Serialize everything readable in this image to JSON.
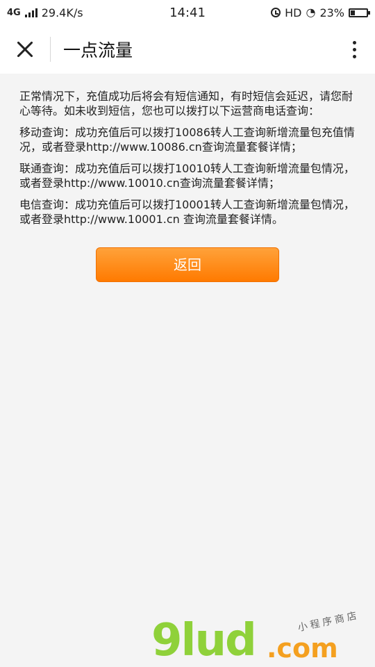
{
  "status_bar": {
    "network_type": "4G",
    "speed": "29.4K/s",
    "time": "14:41",
    "hd_label": "HD",
    "battery": "23%",
    "icons": [
      "signal-icon",
      "alarm-icon",
      "wifi-icon",
      "battery-icon"
    ]
  },
  "header": {
    "title": "一点流量",
    "close_icon": "close-icon",
    "more_icon": "more-icon"
  },
  "main": {
    "intro": "正常情况下，充值成功后将会有短信通知，有时短信会延迟，请您耐心等待。如未收到短信，您也可以拨打以下运营商电话查询：",
    "mobile": "移动查询：成功充值后可以拨打10086转人工查询新增流量包充值情况，或者登录http://www.10086.cn查询流量套餐详情；",
    "unicom": "联通查询：成功充值后可以拨打10010转人工查询新增流量包情况，或者登录http://www.10010.cn查询流量套餐详情；",
    "telecom": "电信查询：成功充值后可以拨打10001转人工查询新增流量包情况，或者登录http://www.10001.cn 查询流量套餐详情。",
    "back_label": "返回"
  },
  "watermark": {
    "brand": "9lud",
    "domain": ".com",
    "tag": "小程序商店"
  },
  "colors": {
    "button_top": "#ffa23a",
    "button_bottom": "#ff7a00",
    "background": "#f4f4f4"
  }
}
